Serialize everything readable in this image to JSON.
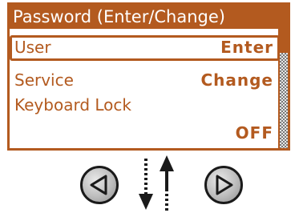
{
  "screen": {
    "title": "Password (Enter/Change)",
    "items": [
      {
        "label": "User",
        "value": "Enter",
        "selected": true
      },
      {
        "label": "Service",
        "value": "Change",
        "selected": false
      },
      {
        "label": "Keyboard Lock",
        "value": "",
        "selected": false
      }
    ],
    "keyboard_lock_value": "OFF",
    "scroll_position": 0.0
  },
  "navigation": {
    "left_button_icon": "triangle-left-icon",
    "right_button_icon": "triangle-right-icon",
    "updown_icon": "up-down-arrows-icon"
  },
  "colors": {
    "accent": "#b35a1f",
    "background": "#ffffff",
    "button_outline": "#1a1a1a"
  }
}
